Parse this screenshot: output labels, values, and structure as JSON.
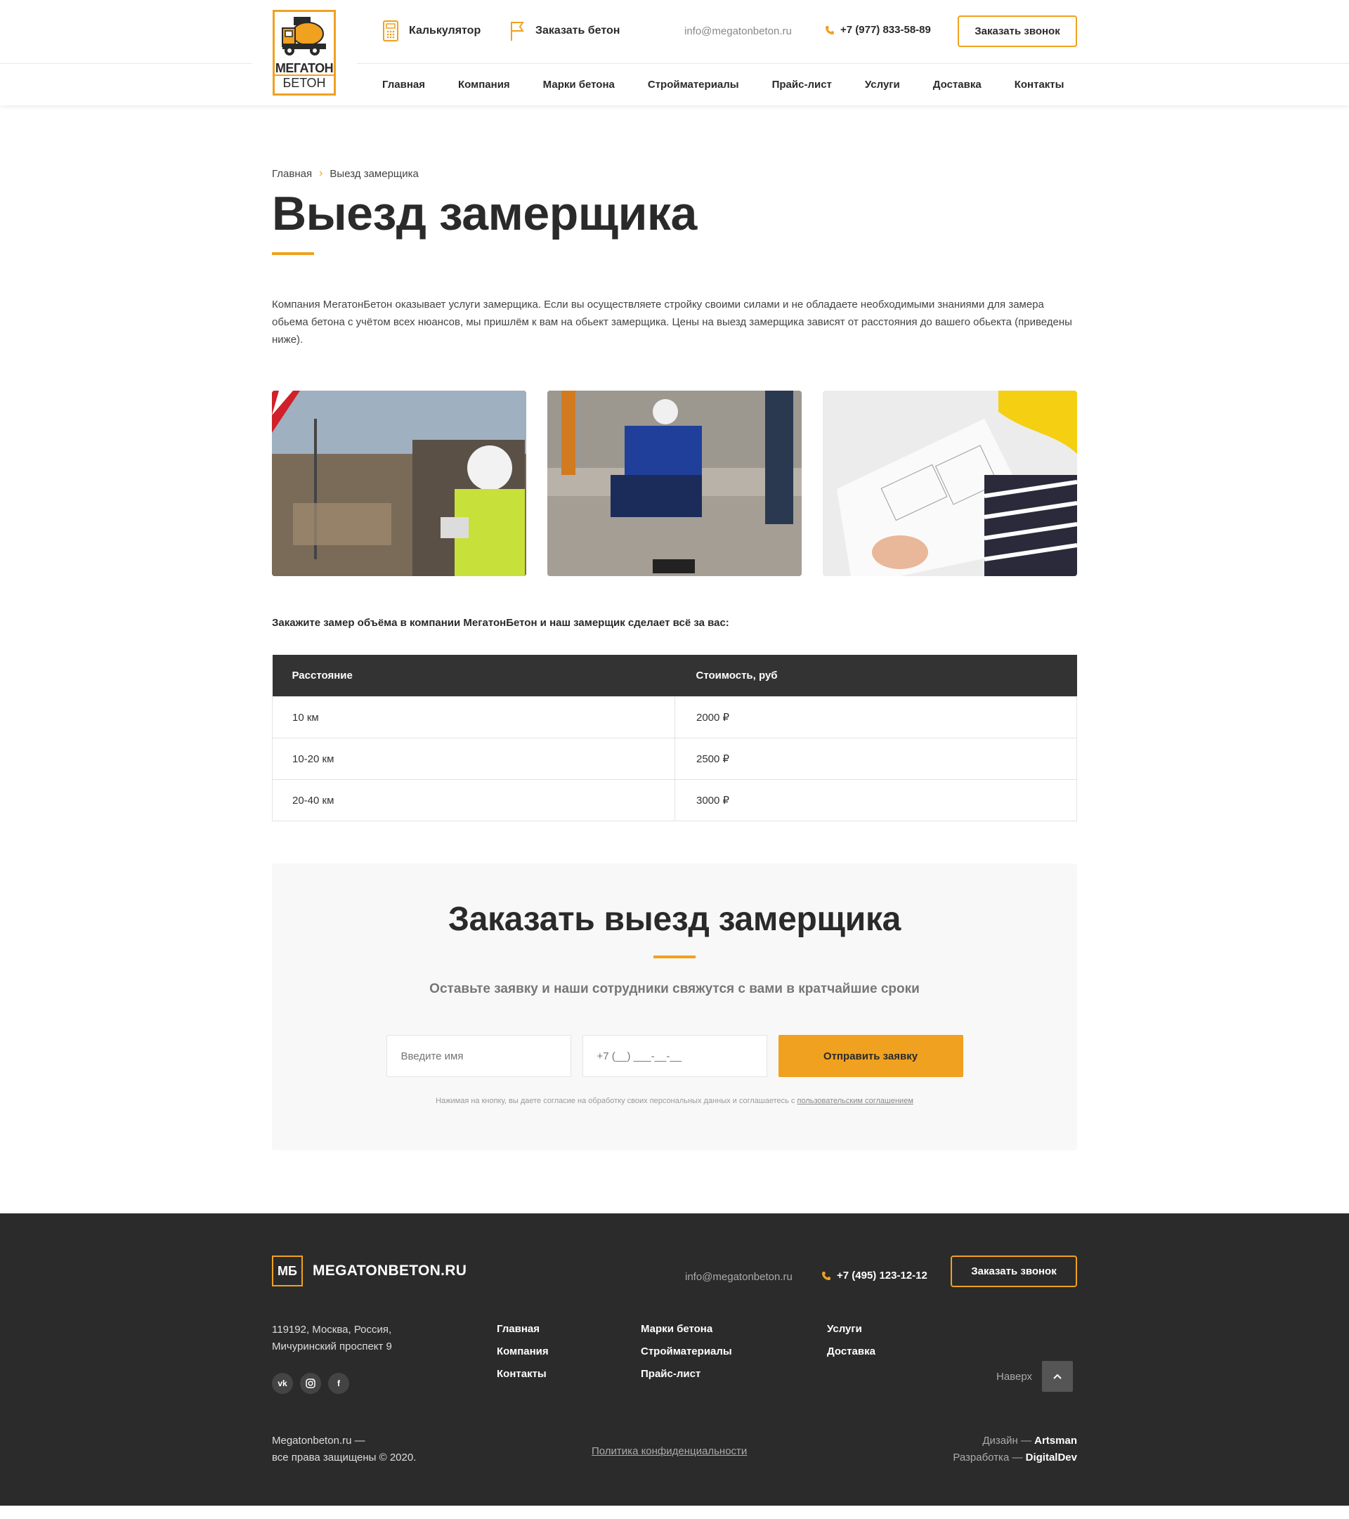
{
  "header": {
    "logo_line1": "МЕГАТОН",
    "logo_line2": "БЕТОН",
    "calculator_label": "Калькулятор",
    "order_concrete_label": "Заказать бетон",
    "email": "info@megatonbeton.ru",
    "phone": "+7 (977) 833-58-89",
    "call_button": "Заказать звонок",
    "nav": [
      "Главная",
      "Компания",
      "Марки бетона",
      "Стройматериалы",
      "Прайс-лист",
      "Услуги",
      "Доставка",
      "Контакты"
    ]
  },
  "breadcrumb": {
    "home": "Главная",
    "current": "Выезд замерщика"
  },
  "page_title": "Выезд замерщика",
  "intro": "Компания МегатонБетон оказывает услуги замерщика. Если вы осуществляете стройку своими силами и не обладаете необходимыми знаниями для замера обьема бетона с учётом всех нюансов, мы пришлём к вам на обьект замерщика. Цены на выезд замерщика зависят от расстояния до вашего обьекта (приведены ниже).",
  "subhead": "Закажите замер объёма в компании МегатонБетон и наш замерщик сделает всё за вас:",
  "table": {
    "headers": [
      "Расстояние",
      "Стоимость, руб"
    ],
    "rows": [
      [
        "10 км",
        "2000 ₽"
      ],
      [
        "10-20 км",
        "2500 ₽"
      ],
      [
        "20-40 км",
        "3000 ₽"
      ]
    ]
  },
  "order_form": {
    "title": "Заказать выезд замерщика",
    "subtitle": "Оставьте заявку и наши сотрудники свяжутся с вами в кратчайшие сроки",
    "name_placeholder": "Введите имя",
    "phone_placeholder": "+7 (__) ___-__-__",
    "submit": "Отправить заявку",
    "consent_text": "Нажимая на кнопку, вы даете согласие на обработку своих персональных данных и соглашаетесь с ",
    "consent_link": "пользовательским соглашением"
  },
  "footer": {
    "logo_mark": "МБ",
    "logo_text": "MEGATONBETON.RU",
    "email": "info@megatonbeton.ru",
    "phone": "+7 (495) 123-12-12",
    "call_button": "Заказать звонок",
    "address_line1": "119192, Москва, Россия,",
    "address_line2": "Мичуринский проспект 9",
    "col1": [
      "Главная",
      "Компания",
      "Контакты"
    ],
    "col2": [
      "Марки бетона",
      "Стройматериалы",
      "Прайс-лист"
    ],
    "col3": [
      "Услуги",
      "Доставка"
    ],
    "up_label": "Наверх",
    "copy_line1": "Megatonbeton.ru —",
    "copy_line2": "все права защищены © 2020.",
    "policy": "Политика конфиденциальности",
    "design_prefix": "Дизайн — ",
    "design_name": "Artsman",
    "dev_prefix": "Разработка — ",
    "dev_name": "DigitalDev",
    "social": [
      "vk-icon",
      "instagram-icon",
      "facebook-icon"
    ]
  },
  "colors": {
    "accent": "#f0a11f",
    "dark": "#2b2b2b",
    "table_head": "#333333"
  }
}
